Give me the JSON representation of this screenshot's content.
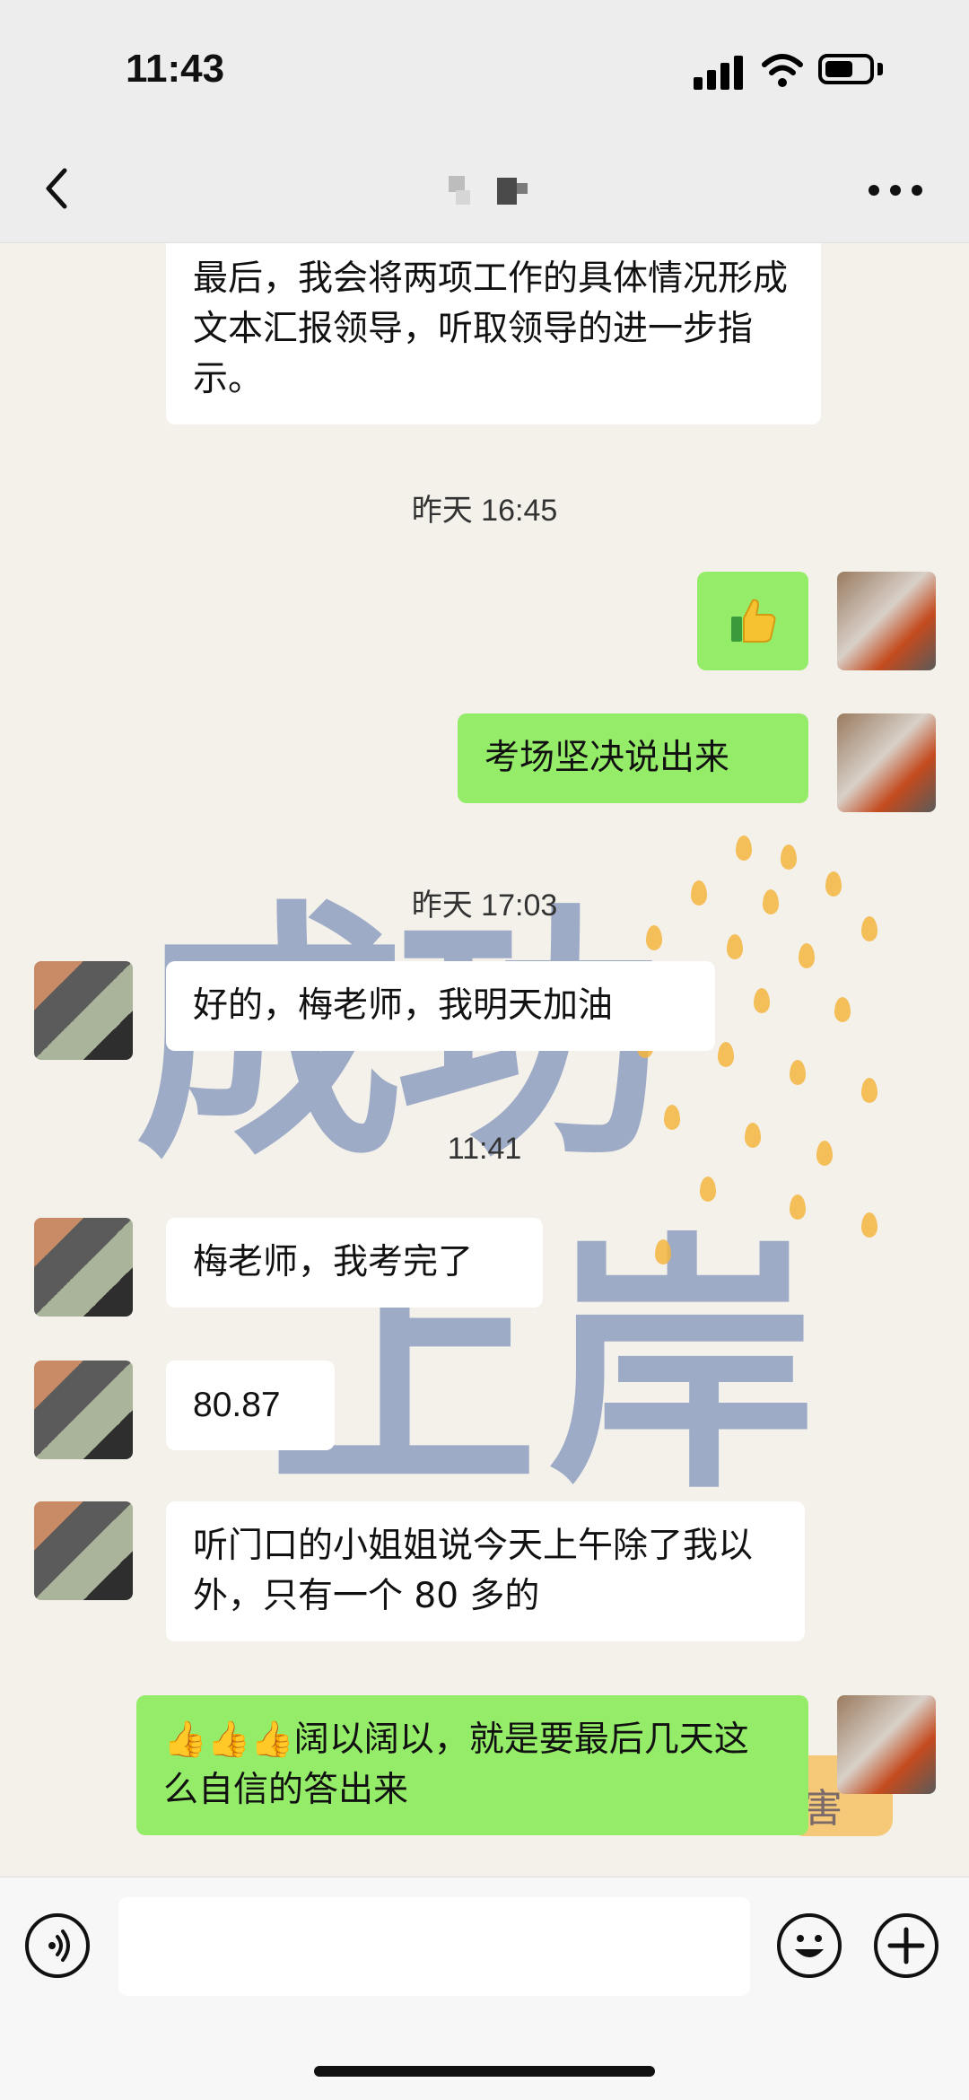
{
  "status_bar": {
    "time": "11:43"
  },
  "nav": {
    "title": ""
  },
  "chat": {
    "messages": [
      {
        "side": "in",
        "text": "最后，我会将两项工作的具体情况形成文本汇报领导，听取领导的进一步指示。"
      },
      {
        "side": "out",
        "text": "",
        "emoji": "thumbs-up"
      },
      {
        "side": "out",
        "text": "考场坚决说出来"
      },
      {
        "side": "in",
        "text": "好的，梅老师，我明天加油"
      },
      {
        "side": "in",
        "text": "梅老师，我考完了"
      },
      {
        "side": "in",
        "text": "80.87"
      },
      {
        "side": "in",
        "text": "听门口的小姐姐说今天上午除了我以外，只有一个 80 多的"
      },
      {
        "side": "out",
        "text": "阔以阔以，就是要最后几天这么自信的答出来",
        "emoji_prefix": "👍👍👍"
      }
    ],
    "timestamps": [
      "昨天 16:45",
      "昨天 17:03",
      "11:41"
    ],
    "watermark": {
      "text": "成功上岸",
      "stamp_text": "害"
    }
  },
  "input_bar": {
    "placeholder": ""
  },
  "colors": {
    "out_bubble": "#95ec69",
    "in_bubble": "#ffffff",
    "chat_bg": "#f3f1ea"
  }
}
